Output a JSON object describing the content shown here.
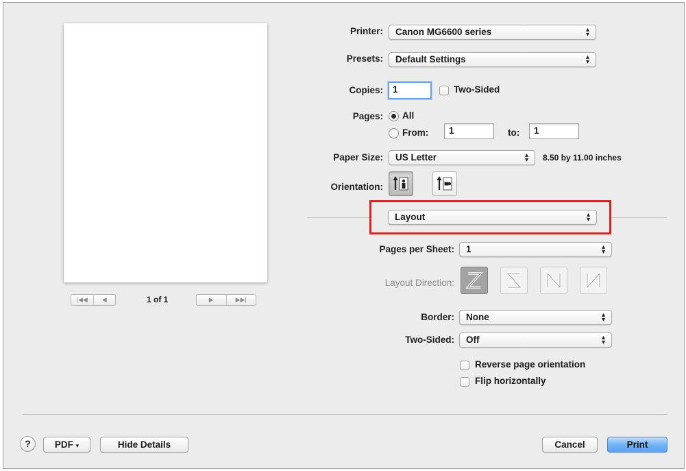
{
  "printer": {
    "label": "Printer:",
    "value": "Canon MG6600 series"
  },
  "presets": {
    "label": "Presets:",
    "value": "Default Settings"
  },
  "copies": {
    "label": "Copies:",
    "value": "1",
    "two_sided_label": "Two-Sided"
  },
  "pages": {
    "label": "Pages:",
    "all_label": "All",
    "from_label": "From:",
    "from_value": "1",
    "to_label": "to:",
    "to_value": "1"
  },
  "paper_size": {
    "label": "Paper Size:",
    "value": "US Letter",
    "dimensions": "8.50 by 11.00 inches"
  },
  "orientation": {
    "label": "Orientation:"
  },
  "section": {
    "value": "Layout",
    "highlight_color": "#d92020"
  },
  "pages_per_sheet": {
    "label": "Pages per Sheet:",
    "value": "1"
  },
  "layout_direction": {
    "label": "Layout Direction:"
  },
  "border": {
    "label": "Border:",
    "value": "None"
  },
  "two_sided": {
    "label": "Two-Sided:",
    "value": "Off"
  },
  "reverse_orientation": {
    "label": "Reverse page orientation"
  },
  "flip_horizontally": {
    "label": "Flip horizontally"
  },
  "preview": {
    "page_indicator": "1 of 1"
  },
  "footer": {
    "help": "?",
    "pdf": "PDF",
    "hide_details": "Hide Details",
    "cancel": "Cancel",
    "print": "Print"
  },
  "icons": {
    "help": "help-icon",
    "popup": "up-down-arrows-icon",
    "orientation_portrait": "portrait-orientation-icon",
    "orientation_landscape": "landscape-orientation-icon"
  }
}
